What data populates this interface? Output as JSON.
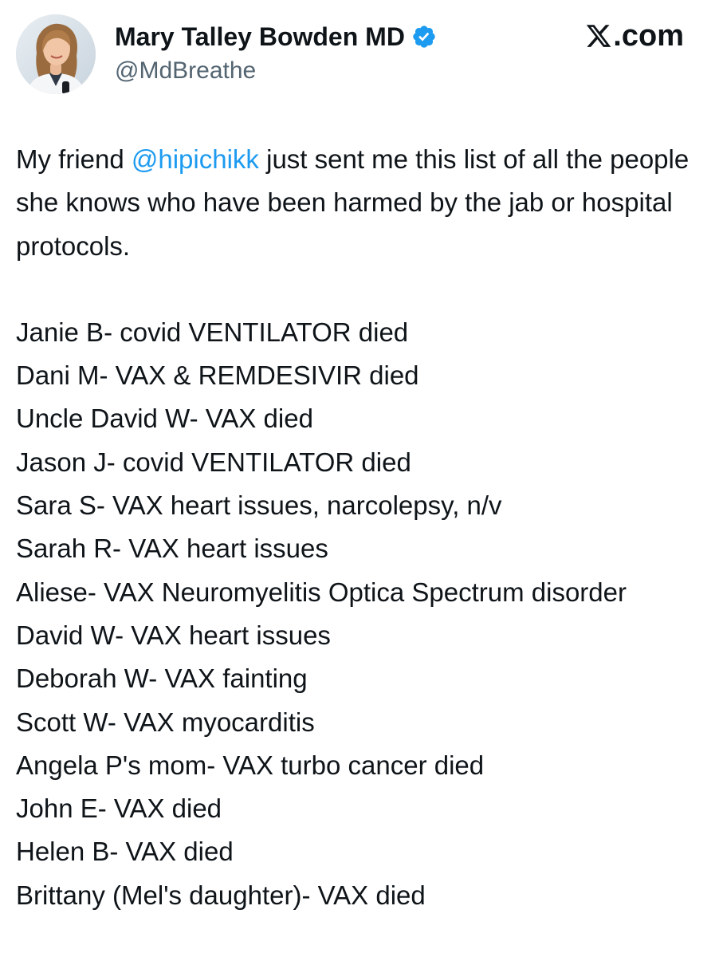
{
  "tweet": {
    "author": {
      "display_name": "Mary Talley Bowden MD",
      "handle": "@MdBreathe",
      "verified": true,
      "verified_icon": "verified-badge-icon",
      "avatar": "profile-photo"
    },
    "site": {
      "logo_icon": "x-logo-icon",
      "suffix": ".com"
    },
    "intro": {
      "before_mention": "My friend ",
      "mention": "@hipichikk",
      "after_mention": " just sent me this list of all the people she knows who have been harmed by the jab or hospital protocols."
    },
    "entries": [
      "Janie B- covid VENTILATOR died",
      "Dani M- VAX & REMDESIVIR died",
      "Uncle David W- VAX died",
      "Jason J- covid VENTILATOR died",
      "Sara S- VAX heart issues, narcolepsy, n/v",
      "Sarah R- VAX heart issues",
      "Aliese- VAX Neuromyelitis Optica Spectrum disorder",
      "David W- VAX heart issues",
      "Deborah W- VAX fainting",
      "Scott W- VAX myocarditis",
      "Angela P's mom- VAX turbo cancer died",
      "John E- VAX died",
      "Helen B- VAX died",
      "Brittany (Mel's daughter)- VAX died"
    ]
  },
  "colors": {
    "text": "#0f1419",
    "secondary_text": "#536471",
    "link": "#1d9bf0",
    "verified": "#1d9bf0",
    "background": "#ffffff"
  }
}
